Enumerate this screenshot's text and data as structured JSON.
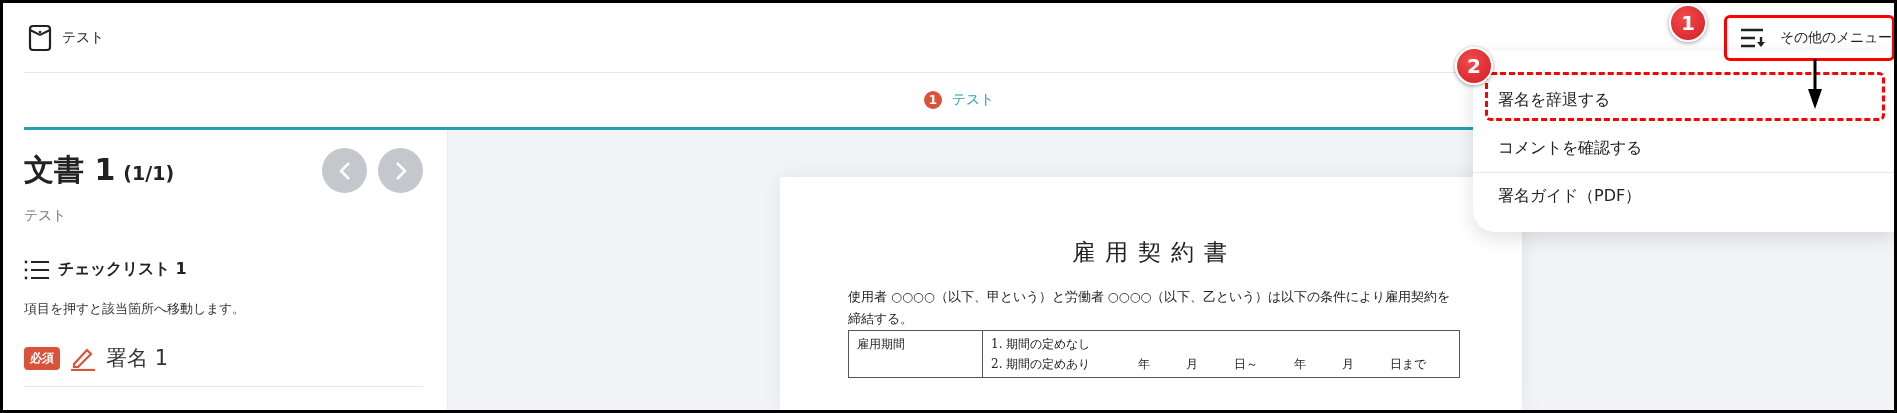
{
  "header": {
    "title": "テスト",
    "menu_button": "その他のメニュー"
  },
  "tabs": [
    {
      "number": "1",
      "label": "テスト",
      "selected": true
    }
  ],
  "document_panel": {
    "title": "文書 1",
    "count": "(1/1)",
    "subtitle": "テスト",
    "checklist_title": "チェックリスト 1",
    "hint": "項目を押すと該当箇所へ移動します。",
    "items": [
      {
        "badge": "必須",
        "label": "署名 1"
      }
    ]
  },
  "menu": {
    "items": [
      {
        "label": "署名を辞退する",
        "separated": false
      },
      {
        "label": "コメントを確認する",
        "separated": false
      },
      {
        "label": "署名ガイド（PDF）",
        "separated": true
      }
    ]
  },
  "document": {
    "title": "雇用契約書",
    "intro": "使用者 ○○○○（以下、甲という）と労働者 ○○○○（以下、乙という）は以下の条件により雇用契約を締結する。",
    "table": [
      {
        "label": "雇用期間",
        "lines": [
          "1. 期間の定めなし",
          "2. 期間の定めあり　　　　年　　　月　　　日～　　　年　　　月　　　日まで"
        ]
      }
    ]
  },
  "annotations": [
    {
      "number": "1",
      "kind": "solid"
    },
    {
      "number": "2",
      "kind": "dashed"
    }
  ]
}
